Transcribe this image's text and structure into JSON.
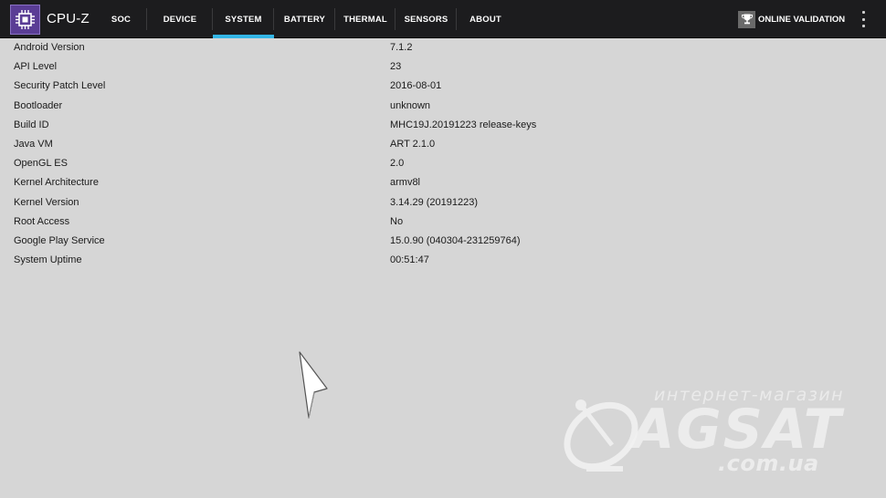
{
  "app": {
    "title": "CPU-Z",
    "logo_icon": "cpu-chip-icon",
    "accent_color": "#33b5e5",
    "toolbar_color": "#1c1c1e"
  },
  "tabs": [
    {
      "label": "SOC",
      "active": false
    },
    {
      "label": "DEVICE",
      "active": false
    },
    {
      "label": "SYSTEM",
      "active": true
    },
    {
      "label": "BATTERY",
      "active": false
    },
    {
      "label": "THERMAL",
      "active": false
    },
    {
      "label": "SENSORS",
      "active": false
    },
    {
      "label": "ABOUT",
      "active": false
    }
  ],
  "toolbar": {
    "validation_label": "ONLINE VALIDATION",
    "validation_icon": "trophy-icon",
    "overflow_icon": "more-vert-icon"
  },
  "system_info": [
    {
      "label": "Android Version",
      "value": "7.1.2"
    },
    {
      "label": "API Level",
      "value": "23"
    },
    {
      "label": "Security Patch Level",
      "value": "2016-08-01"
    },
    {
      "label": "Bootloader",
      "value": "unknown"
    },
    {
      "label": "Build ID",
      "value": "MHC19J.20191223 release-keys"
    },
    {
      "label": "Java VM",
      "value": "ART 2.1.0"
    },
    {
      "label": "OpenGL ES",
      "value": "2.0"
    },
    {
      "label": "Kernel Architecture",
      "value": "armv8l"
    },
    {
      "label": "Kernel Version",
      "value": "3.14.29 (20191223)"
    },
    {
      "label": "Root Access",
      "value": "No"
    },
    {
      "label": "Google Play Service",
      "value": "15.0.90 (040304-231259764)"
    },
    {
      "label": "System Uptime",
      "value": "00:51:47"
    }
  ],
  "watermark": {
    "top_text": "интернет-магазин",
    "main_text": "AGSAT",
    "bottom_text": ".com.ua"
  }
}
